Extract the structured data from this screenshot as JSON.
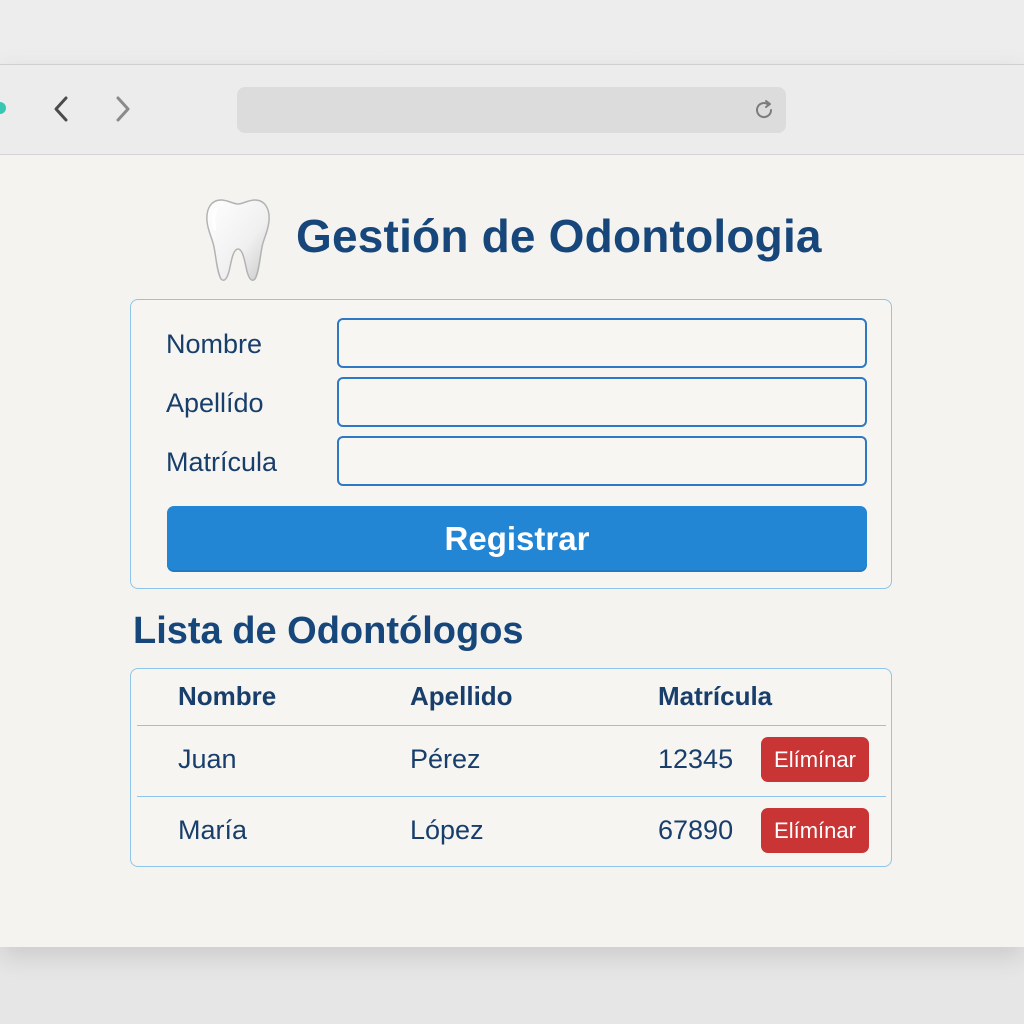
{
  "browser": {
    "back_icon": "chevron-left-icon",
    "forward_icon": "chevron-right-icon",
    "address": "",
    "reload_icon": "reload-icon"
  },
  "header": {
    "icon": "tooth-icon",
    "title": "Gestión de Odontologia"
  },
  "form": {
    "fields": [
      {
        "label": "Nombre",
        "value": "",
        "placeholder": ""
      },
      {
        "label": "Apellído",
        "value": "",
        "placeholder": ""
      },
      {
        "label": "Matrícula",
        "value": "",
        "placeholder": ""
      }
    ],
    "submit_label": "Registrar"
  },
  "list": {
    "title": "Lista de Odontólogos",
    "columns": [
      "Nombre",
      "Apellido",
      "Matrícula"
    ],
    "rows": [
      {
        "nombre": "Juan",
        "apellido": "Pérez",
        "matricula": "12345",
        "action_label": "Elímínar"
      },
      {
        "nombre": "María",
        "apellido": "López",
        "matricula": "67890",
        "action_label": "Elímínar"
      }
    ]
  },
  "colors": {
    "primary": "#2386d4",
    "danger": "#c93434",
    "text": "#16467a",
    "border": "#8ec5e8",
    "background": "#f4f3ef"
  }
}
